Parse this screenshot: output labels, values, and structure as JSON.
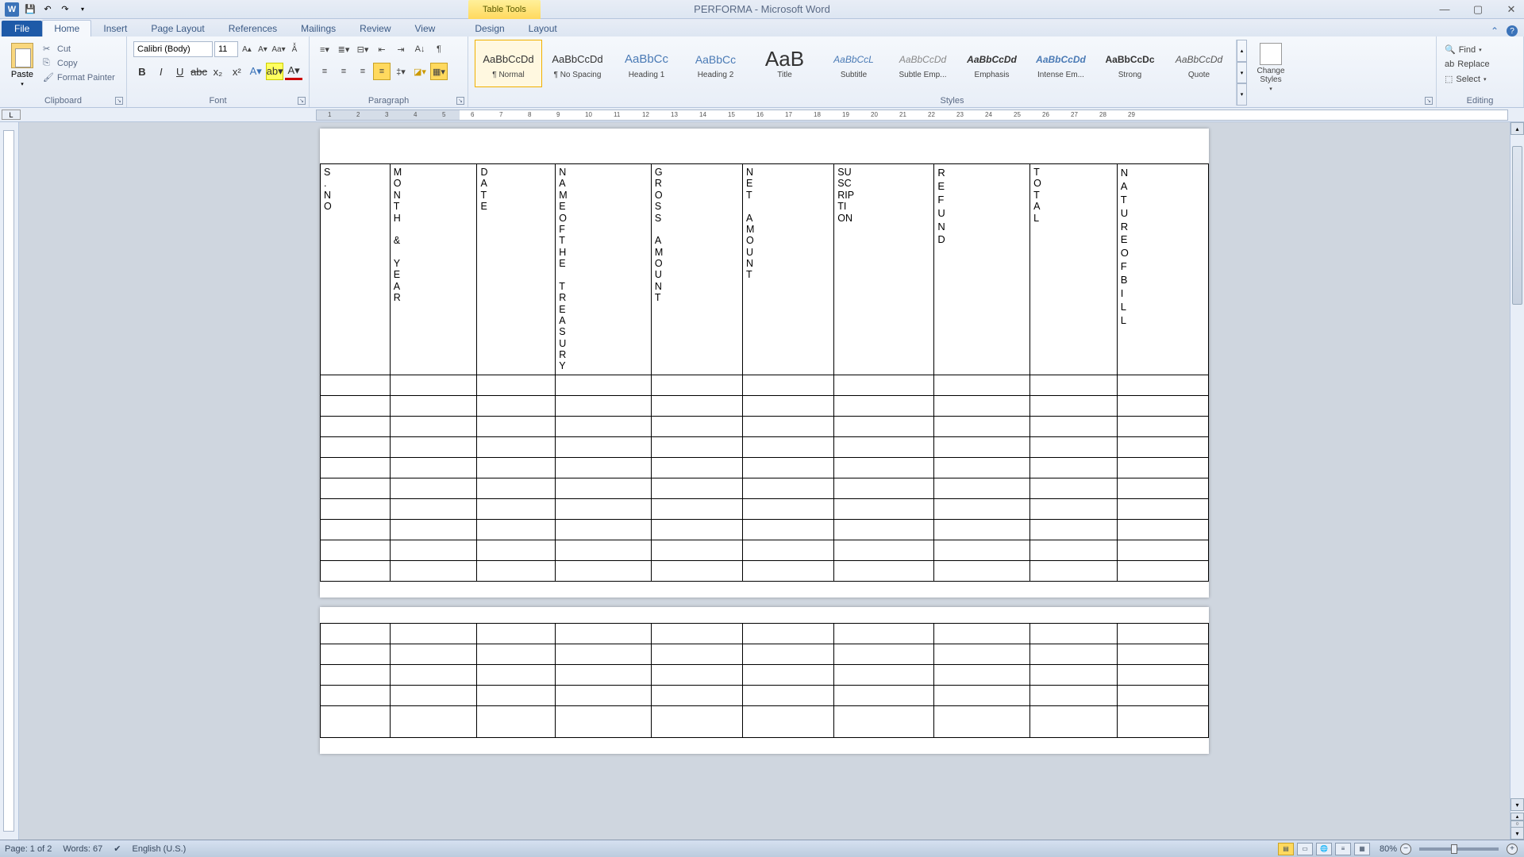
{
  "title": "PERFORMA - Microsoft Word",
  "table_tools": "Table Tools",
  "tabs": [
    "Home",
    "Insert",
    "Page Layout",
    "References",
    "Mailings",
    "Review",
    "View",
    "Design",
    "Layout"
  ],
  "file_tab": "File",
  "clipboard": {
    "label": "Clipboard",
    "paste": "Paste",
    "cut": "Cut",
    "copy": "Copy",
    "format_painter": "Format Painter"
  },
  "font": {
    "label": "Font",
    "name": "Calibri (Body)",
    "size": "11"
  },
  "paragraph": {
    "label": "Paragraph"
  },
  "styles": {
    "label": "Styles",
    "change": "Change Styles",
    "items": [
      {
        "preview": "AaBbCcDd",
        "name": "¶ Normal",
        "cls": ""
      },
      {
        "preview": "AaBbCcDd",
        "name": "¶ No Spacing",
        "cls": ""
      },
      {
        "preview": "AaBbCc",
        "name": "Heading 1",
        "cls": "h1"
      },
      {
        "preview": "AaBbCc",
        "name": "Heading 2",
        "cls": "h2"
      },
      {
        "preview": "AaB",
        "name": "Title",
        "cls": "title"
      },
      {
        "preview": "AaBbCcL",
        "name": "Subtitle",
        "cls": "subtitle"
      },
      {
        "preview": "AaBbCcDd",
        "name": "Subtle Emp...",
        "cls": "subtle-em"
      },
      {
        "preview": "AaBbCcDd",
        "name": "Emphasis",
        "cls": "emphasis"
      },
      {
        "preview": "AaBbCcDd",
        "name": "Intense Em...",
        "cls": "intense"
      },
      {
        "preview": "AaBbCcDc",
        "name": "Strong",
        "cls": "strong"
      },
      {
        "preview": "AaBbCcDd",
        "name": "Quote",
        "cls": "quote"
      }
    ]
  },
  "editing": {
    "label": "Editing",
    "find": "Find",
    "replace": "Replace",
    "select": "Select"
  },
  "ruler_marks": [
    "1",
    "2",
    "3",
    "4",
    "5",
    "6",
    "7",
    "8",
    "9",
    "10",
    "11",
    "12",
    "13",
    "14",
    "15",
    "16",
    "17",
    "18",
    "19",
    "20",
    "21",
    "22",
    "23",
    "24",
    "25",
    "26",
    "27",
    "28",
    "29"
  ],
  "table_headers": [
    [
      "S",
      ".",
      "N",
      "O"
    ],
    [
      "M",
      "O",
      "N",
      "T",
      "H",
      "",
      "&",
      "",
      "Y",
      "E",
      "A",
      "R"
    ],
    [
      "D",
      "A",
      "T",
      "E"
    ],
    [
      "N",
      "A",
      "M",
      "E",
      "O",
      "F",
      "T",
      "H",
      "E",
      "",
      "T",
      "R",
      "E",
      "A",
      "S",
      "U",
      "R",
      "Y"
    ],
    [
      "G",
      "R",
      "O",
      "S",
      "S",
      "",
      "A",
      "M",
      "O",
      "U",
      "N",
      "T"
    ],
    [
      "N",
      "E",
      "T",
      "",
      "A",
      "M",
      "O",
      "U",
      "N",
      "T"
    ],
    [
      "SU",
      "SC",
      "RIP",
      "TI",
      "ON"
    ],
    [
      "R",
      "E",
      "F",
      "U",
      "N",
      "D"
    ],
    [
      "T",
      "O",
      "T",
      "A",
      "L"
    ],
    [
      "N",
      "A",
      "T",
      "U",
      "R",
      "E",
      "O",
      "F",
      "B",
      "I",
      "L",
      "L"
    ]
  ],
  "status": {
    "page": "Page: 1 of 2",
    "words": "Words: 67",
    "lang": "English (U.S.)",
    "zoom": "80%"
  }
}
